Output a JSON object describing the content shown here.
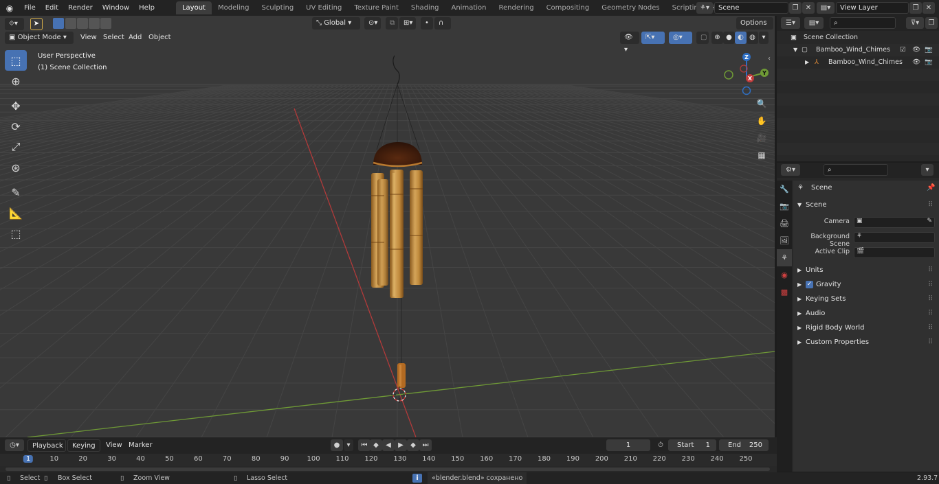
{
  "menubar": {
    "items": [
      "File",
      "Edit",
      "Render",
      "Window",
      "Help"
    ],
    "workspaces": [
      "Layout",
      "Modeling",
      "Sculpting",
      "UV Editing",
      "Texture Paint",
      "Shading",
      "Animation",
      "Rendering",
      "Compositing",
      "Geometry Nodes",
      "Scripting"
    ],
    "active_workspace": "Layout",
    "add_workspace": "+",
    "scene_name": "Scene",
    "view_layer": "View Layer"
  },
  "tool_header": {
    "orientation": "Global",
    "options_label": "Options"
  },
  "viewport_header": {
    "mode": "Object Mode",
    "menus": [
      "View",
      "Select",
      "Add",
      "Object"
    ]
  },
  "viewport": {
    "perspective_label": "User Perspective",
    "collection_label": "(1) Scene Collection",
    "gizmo": {
      "z": "Z",
      "y": "Y",
      "x": "X"
    }
  },
  "outliner": {
    "rows": [
      {
        "label": "Scene Collection"
      },
      {
        "label": "Bamboo_Wind_Chimes"
      },
      {
        "label": "Bamboo_Wind_Chimes"
      }
    ]
  },
  "properties": {
    "context_label": "Scene",
    "panel_title": "Scene",
    "fields": [
      {
        "label": "Camera"
      },
      {
        "label": "Background Scene"
      },
      {
        "label": "Active Clip"
      }
    ],
    "subpanels": [
      "Units",
      "Gravity",
      "Keying Sets",
      "Audio",
      "Rigid Body World",
      "Custom Properties"
    ],
    "gravity_enabled": true
  },
  "timeline": {
    "menus": [
      "Playback",
      "Keying",
      "View",
      "Marker"
    ],
    "current_frame": "1",
    "start_label": "Start",
    "start_value": "1",
    "end_label": "End",
    "end_value": "250",
    "ruler_ticks": [
      "1",
      "10",
      "20",
      "30",
      "40",
      "50",
      "60",
      "70",
      "80",
      "90",
      "100",
      "110",
      "120",
      "130",
      "140",
      "150",
      "160",
      "170",
      "180",
      "190",
      "200",
      "210",
      "220",
      "230",
      "240",
      "250"
    ]
  },
  "statusbar": {
    "select": "Select",
    "box_select": "Box Select",
    "zoom_view": "Zoom View",
    "lasso_select": "Lasso Select",
    "message": "«blender.blend» сохранено",
    "version": "2.93.7"
  },
  "colors": {
    "accent": "#4772b3",
    "x_axis": "#c23b3b",
    "y_axis": "#7aa83a",
    "viewport_bg": "#393939"
  }
}
